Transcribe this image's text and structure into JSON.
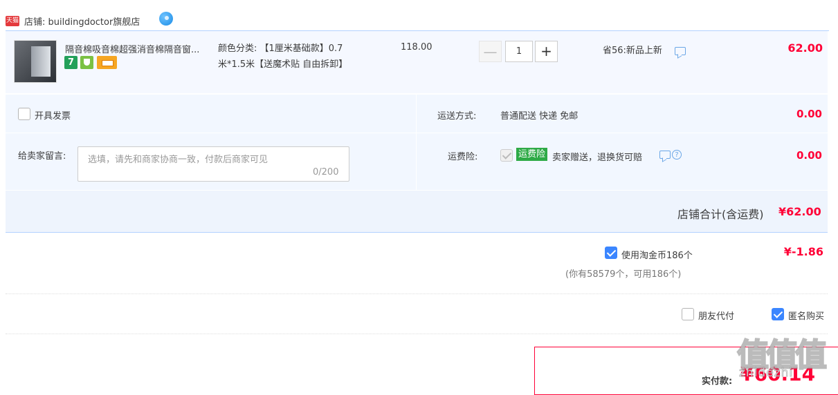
{
  "shop": {
    "badge": "天猫",
    "label": "店铺: buildingdoctor旗舰店"
  },
  "item": {
    "title": "隔音棉吸音棉超强消音棉隔音窗...",
    "badge_seven": "7",
    "sku_line1": "颜色分类: 【1厘米基础款】0.7",
    "sku_line2": "米*1.5米【送魔术贴 自由拆卸】",
    "unit_price": "118.00",
    "qty_minus": "—",
    "quantity": "1",
    "qty_plus": "+",
    "promo": "省56:新品上新",
    "total": "62.00"
  },
  "invoice": {
    "label": "开具发票"
  },
  "shipping": {
    "label": "运送方式:",
    "value": "普通配送 快递 免邮",
    "amount": "0.00"
  },
  "memo": {
    "label": "给卖家留言:",
    "placeholder": "选填，请先和商家协商一致，付款后商家可见",
    "count": "0/200"
  },
  "insurance": {
    "label": "运费险:",
    "tag": "运费险",
    "desc": "卖家赠送，退换货可赔",
    "help": "?",
    "amount": "0.00"
  },
  "shop_total": {
    "label": "店铺合计(含运费)",
    "value": "¥62.00"
  },
  "coins": {
    "label": "使用淘金币186个",
    "value": "¥-1.86",
    "note": "(你有58579个，可用186个)"
  },
  "options": {
    "friend_pay": "朋友代付",
    "anonymous": "匿名购买"
  },
  "payment": {
    "label": "实付款:",
    "value": "¥60.14"
  },
  "watermark": {
    "text": "值值值",
    "url": "zhidezhi"
  },
  "colors": {
    "price_red": "#ff0036",
    "accent_blue": "#3b86ff",
    "insurance_green": "#2eaa46"
  }
}
